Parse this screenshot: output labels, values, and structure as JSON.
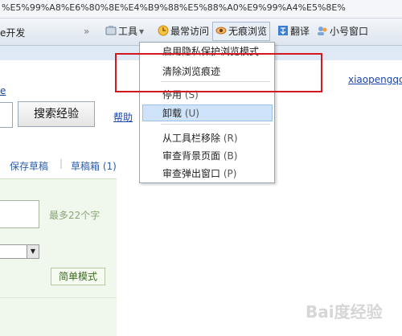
{
  "address_bar": {
    "text": "%E5%99%A8%E6%80%8E%E4%B9%88%E5%88%A0%E9%99%A4%E5%8E%"
  },
  "toolbar": {
    "left_text": "e开发",
    "overflow": "»",
    "tools_label": "工具",
    "tools_arrow": "▾",
    "frequent_label": "最常访问",
    "incognito_label": "无痕浏览",
    "translate_label": "翻译",
    "account_label": "小号窗口"
  },
  "page": {
    "edge_link": "e",
    "user_link": "xiaopengqcx",
    "search_button": "搜索经验",
    "help_link": "帮助",
    "save_draft": "保存草稿",
    "drafts": "草稿箱 (1)",
    "hint": "最多22个字",
    "simple_mode": "简单模式",
    "select_arrow": "▼"
  },
  "menu": {
    "items": [
      {
        "label": "启用隐私保护浏览模式"
      },
      {
        "label": "清除浏览痕迹"
      },
      {
        "label": "停用",
        "key": "(S)"
      },
      {
        "label": "卸载",
        "key": "(U)"
      },
      {
        "label": "从工具栏移除",
        "key": "(R)"
      },
      {
        "label": "审查背景页面",
        "key": "(B)"
      },
      {
        "label": "审查弹出窗口",
        "key": "(P)"
      }
    ]
  },
  "watermark": "Bai度经验",
  "colors": {
    "highlight_box": "#d4181f",
    "menu_hover": "#cfe4fa",
    "panel_bg": "#f0f7ec",
    "link": "#1a45a8"
  }
}
